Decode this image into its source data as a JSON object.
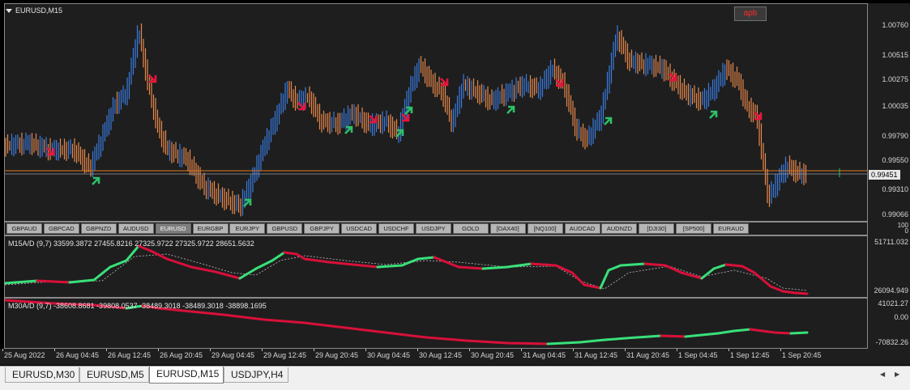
{
  "window": {
    "title": "EURUSD,M15",
    "badge": "apb"
  },
  "main_chart": {
    "price_axis": [
      "1.00760",
      "1.00515",
      "1.00275",
      "1.00035",
      "0.99790",
      "0.99550",
      "0.99310",
      "0.99066"
    ],
    "current_price": "0.99451",
    "colors": {
      "bull": "#3a7be0",
      "bear": "#e8884a",
      "buy_arrow": "#2ebf6a",
      "sell_arrow": "#e8143c",
      "price_line": "#e07820"
    }
  },
  "symbol_bar": {
    "items": [
      "GBPAUD",
      "GBPCAD",
      "GBPNZD",
      "AUDUSD",
      "EURUSD",
      "EURGBP",
      "EURJPY",
      "GBPUSD",
      "GBPJPY",
      "USDCAD",
      "USDCHF",
      "USDJPY",
      "GOLD",
      "[DAX40]",
      "[NQ100]",
      "AUDCAD",
      "AUDNZD",
      "[DJI30]",
      "[SP500]",
      "EURAUD"
    ],
    "active": "EURUSD",
    "axis_top": "100",
    "axis_bottom": "0"
  },
  "indicator1": {
    "label": "M15A/D (9,7) 33599.3872 27455.8216 27325.9722 27325.9722 28651.5632",
    "axis": [
      "51711.032",
      "26094.949"
    ],
    "colors": {
      "up": "#39e07a",
      "down": "#d8103a",
      "signal": "#bfbfbf"
    }
  },
  "indicator2": {
    "label": "M30A/D (9,7) -38608.8681 -39808.0537 -38489.3018 -38489.3018 -38898.1695",
    "axis": [
      "41021.27",
      "0.00",
      "-70832.26"
    ],
    "colors": {
      "up": "#39e07a",
      "down": "#d8103a"
    }
  },
  "time_axis": [
    "25 Aug 2022",
    "26 Aug 04:45",
    "26 Aug 12:45",
    "26 Aug 20:45",
    "29 Aug 04:45",
    "29 Aug 12:45",
    "29 Aug 20:45",
    "30 Aug 04:45",
    "30 Aug 12:45",
    "30 Aug 20:45",
    "31 Aug 04:45",
    "31 Aug 12:45",
    "31 Aug 20:45",
    "1 Sep 04:45",
    "1 Sep 12:45",
    "1 Sep 20:45"
  ],
  "tabs": [
    "EURUSD,M30",
    "EURUSD,M5",
    "EURUSD,M15",
    "USDJPY,H4"
  ],
  "active_tab": "EURUSD,M15"
}
